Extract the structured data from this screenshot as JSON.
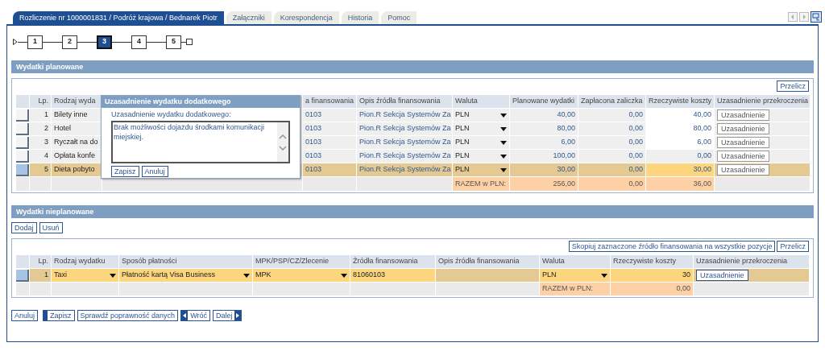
{
  "tabs": [
    {
      "label": "Rozliczenie nr 1000001831 / Podróż krajowa / Bednarek Piotr",
      "selected": true
    },
    {
      "label": "Załączniki",
      "selected": false
    },
    {
      "label": "Korespondencja",
      "selected": false
    },
    {
      "label": "Historia",
      "selected": false
    },
    {
      "label": "Pomoc",
      "selected": false
    }
  ],
  "steps": [
    {
      "label": "1",
      "selected": false
    },
    {
      "label": "2",
      "selected": false
    },
    {
      "label": "3",
      "selected": true
    },
    {
      "label": "4",
      "selected": false
    },
    {
      "label": "5",
      "selected": false
    }
  ],
  "planned": {
    "title": "Wydatki planowane",
    "toolbar": [
      "Przelicz"
    ],
    "columns": [
      "Lp.",
      "Rodzaj wyda",
      "a finansowania",
      "Opis źródła finansowania",
      "Waluta",
      "Planowane wydatki",
      "Zapłacona zaliczka",
      "Rzeczywiste koszty",
      "Uzasadnienie przekroczenia"
    ],
    "rows": [
      {
        "selected": false,
        "lp": "1",
        "type": "Bilety inne",
        "source": "0103",
        "source_desc": "Pion.R Sekcja Systemów Za",
        "currency": "PLN",
        "planned": "40,00",
        "advance": "0,00",
        "actual": "40,00",
        "actual_editable": true,
        "justify": {
          "label": "Uzasadnienie",
          "disabled": true
        }
      },
      {
        "selected": false,
        "lp": "2",
        "type": "Hotel",
        "source": "0103",
        "source_desc": "Pion.R Sekcja Systemów Za",
        "currency": "PLN",
        "planned": "80,00",
        "advance": "0,00",
        "actual": "80,00",
        "actual_editable": true,
        "justify": {
          "label": "Uzasadnienie",
          "disabled": true
        }
      },
      {
        "selected": false,
        "lp": "3",
        "type": "Ryczałt na do",
        "source": "0103",
        "source_desc": "Pion.R Sekcja Systemów Za",
        "currency": "PLN",
        "planned": "6,00",
        "advance": "0,00",
        "actual": "6,00",
        "actual_editable": true,
        "justify": {
          "label": "Uzasadnienie",
          "disabled": true
        }
      },
      {
        "selected": false,
        "lp": "4",
        "type": "Opłata konfe",
        "source": "0103",
        "source_desc": "Pion.R Sekcja Systemów Za",
        "currency": "PLN",
        "planned": "100,00",
        "advance": "0,00",
        "actual": "0,00",
        "actual_editable": false,
        "justify": {
          "label": "Uzasadnienie",
          "disabled": true
        }
      },
      {
        "selected": true,
        "lp": "5",
        "type": "Dieta pobyto",
        "source": "0103",
        "source_desc": "Pion.R Sekcja Systemów Za",
        "currency": "PLN",
        "planned": "30,00",
        "advance": "0,00",
        "actual": "30,00",
        "actual_editable": true,
        "justify": {
          "label": "Uzasadnienie",
          "disabled": true
        }
      }
    ],
    "total": {
      "label": "RAZEM w PLN:",
      "planned": "256,00",
      "advance": "0,00",
      "actual": "36,00"
    }
  },
  "dialog": {
    "title": "Uzasadnienie wydatku dodatkowego",
    "label": "Uzasadnienie wydatku dodatkowego:",
    "value": "Brak możliwości dojazdu środkami komunikacji miejskiej.",
    "buttons": [
      "Zapisz",
      "Anuluj"
    ]
  },
  "unplanned": {
    "title": "Wydatki nieplanowane",
    "actions": [
      "Dodaj",
      "Usuń"
    ],
    "toolbar": [
      "Skopiuj zaznaczone źródło finansowania na wszystkie pozycje",
      "Przelicz"
    ],
    "columns": [
      "Lp.",
      "Rodzaj wydatku",
      "Sposób płatności",
      "MPK/PSP/CZ/Zlecenie",
      "Źródła finansowania",
      "Opis źródła finansowania",
      "Waluta",
      "Rzeczywiste koszty",
      "Uzasadnienie przekroczenia"
    ],
    "rows": [
      {
        "selected": true,
        "lp": "1",
        "type": "Taxi",
        "payment": "Płatność kartą Visa Business",
        "mpk": "MPK",
        "source": "81060103",
        "currency": "PLN",
        "actual": "30",
        "justify": {
          "label": "Uzasadnienie",
          "disabled": false
        }
      }
    ],
    "total": {
      "label": "RAZEM w PLN:",
      "actual": "0,00"
    }
  },
  "footer_buttons": [
    {
      "label": "Anuluj",
      "kind": "plain"
    },
    {
      "label": "Zapisz",
      "kind": "primary"
    },
    {
      "label": "Sprawdź poprawność danych",
      "kind": "plain"
    },
    {
      "label": "Wróć",
      "kind": "back"
    },
    {
      "label": "Dalej",
      "kind": "next"
    }
  ]
}
